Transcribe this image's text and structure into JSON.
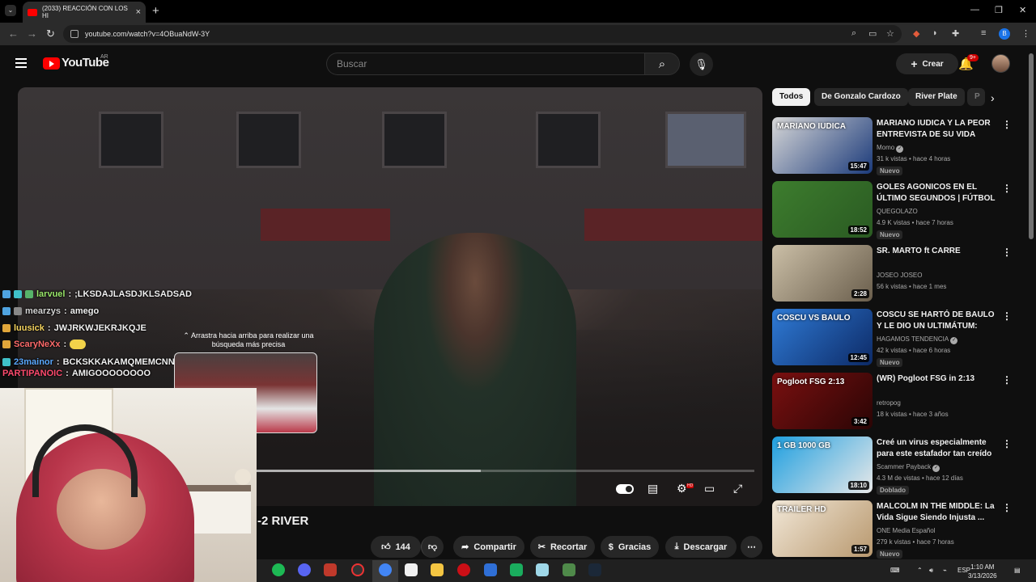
{
  "browser": {
    "tab_title": "(2033) REACCIÓN CON LOS HI",
    "url": "youtube.com/watch?v=4OBuaNdW-3Y",
    "profile_initial": "B"
  },
  "header": {
    "logo_text": "YouTube",
    "country_code": "AR",
    "search_placeholder": "Buscar",
    "create_label": "Crear",
    "notifications_count": "9+"
  },
  "chat": [
    {
      "user": "larvuel",
      "text": ";LKSDAJLASDJKLSADSAD",
      "color": "#9be86b"
    },
    {
      "user": "mearzys",
      "text": "amego",
      "color": "#d4d4d4"
    },
    {
      "user": "luusick",
      "text": "JWJRKWJEKRJKQJE",
      "color": "#f4d35e"
    },
    {
      "user": "ScaryNeXx",
      "text": "",
      "color": "#ff6b6b"
    },
    {
      "user": "23mainor",
      "text": "BCKSKKAKAMQMEMCNNCC",
      "color": "#5aa9ff"
    },
    {
      "user": "PARTIPANOIC",
      "text": "AMIGOOOOOOOO",
      "color": "#ff4b6e"
    }
  ],
  "player": {
    "drag_hint": "Arrastra hacia arriba para realizar una búsqueda más precisa",
    "progress": 0.45,
    "hd_label": "HD"
  },
  "video": {
    "title_fragment": "-2 RIVER",
    "likes": "144",
    "share_label": "Compartir",
    "clip_label": "Recortar",
    "thanks_label": "Gracias",
    "download_label": "Descargar"
  },
  "chips": [
    "Todos",
    "De Gonzalo Cardozo",
    "River Plate",
    "P"
  ],
  "recommendations": [
    {
      "title": "MARIANO IUDICA Y LA PEOR ENTREVISTA DE SU VIDA",
      "channel": "Momo",
      "verified": true,
      "meta": "31 k vistas • hace 4 horas",
      "tag": "Nuevo",
      "duration": "15:47",
      "thumb_colors": [
        "#d8d8d8",
        "#1b3a7a"
      ],
      "thumb_text": "MARIANO IUDICA"
    },
    {
      "title": "GOLES AGONICOS EN EL ÚLTIMO SEGUNDOS | FÚTBOL ...",
      "channel": "QUEGOLAZO",
      "verified": false,
      "meta": "4.9 K vistas • hace 7 horas",
      "tag": "Nuevo",
      "duration": "18:52",
      "thumb_colors": [
        "#3d7d2e",
        "#2a5a22"
      ],
      "thumb_text": ""
    },
    {
      "title": "SR. MARTO ft CARRE",
      "channel": "JOSEO JOSEO",
      "verified": false,
      "meta": "56 k vistas • hace 1 mes",
      "tag": "",
      "duration": "2:28",
      "thumb_colors": [
        "#cbbfa7",
        "#6a5e4c"
      ],
      "thumb_text": ""
    },
    {
      "title": "COSCU SE HARTÓ DE BAULO Y LE DIO UN ULTIMÁTUM: \"Segu...",
      "channel": "HAGAMOS TENDENCIA",
      "verified": true,
      "meta": "42 k vistas • hace 6 horas",
      "tag": "Nuevo",
      "duration": "12:45",
      "thumb_colors": [
        "#2f7bd6",
        "#0d2a66"
      ],
      "thumb_text": "COSCU VS BAULO"
    },
    {
      "title": "(WR) Pogloot FSG in 2:13",
      "channel": "retropog",
      "verified": false,
      "meta": "18 k vistas • hace 3 años",
      "tag": "",
      "duration": "3:42",
      "thumb_colors": [
        "#7a1010",
        "#2a0505"
      ],
      "thumb_text": "Pogloot FSG 2:13"
    },
    {
      "title": "Creé un virus especialmente para este estafador tan creído",
      "channel": "Scammer Payback",
      "verified": true,
      "meta": "4.3 M de vistas • hace 12 días",
      "tag": "Doblado",
      "duration": "18:10",
      "thumb_colors": [
        "#1e9fe0",
        "#e8e8e8"
      ],
      "thumb_text": "1 GB 1000 GB"
    },
    {
      "title": "MALCOLM IN THE MIDDLE: La Vida Sigue Siendo Injusta ...",
      "channel": "ONE Media Español",
      "verified": false,
      "meta": "279 k vistas • hace 7 horas",
      "tag": "Nuevo",
      "duration": "1:57",
      "thumb_colors": [
        "#f2e8d8",
        "#b8986e"
      ],
      "thumb_text": "TRAILER HD"
    }
  ],
  "taskbar": {
    "language": "ESP",
    "time": "1:10 AM",
    "date": "3/13/2026"
  }
}
